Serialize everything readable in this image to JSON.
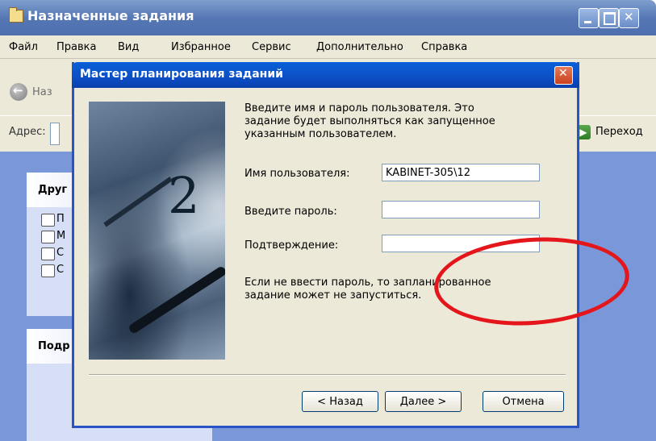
{
  "main_window": {
    "title": "Назначенные задания",
    "menu": [
      "Файл",
      "Правка",
      "Вид",
      "Избранное",
      "Сервис",
      "Дополнительно",
      "Справка"
    ],
    "back_label": "Наз",
    "address_label": "Адрес:",
    "go_label": "Переход",
    "panel_other_title": "Друг",
    "panel_details_title": "Подр",
    "panel_links": [
      "П",
      "М",
      "С",
      "С"
    ]
  },
  "wizard": {
    "title": "Мастер планирования заданий",
    "intro": "Введите имя и пароль пользователя.  Это задание будет выполняться как запущенное указанным пользователем.",
    "username_label": "Имя пользователя:",
    "username_value": "KABINET-305\\12",
    "password_label": "Введите пароль:",
    "password_value": "",
    "confirm_label": "Подтверждение:",
    "confirm_value": "",
    "note": "Если не ввести пароль, то запланированное задание может не запуститься.",
    "buttons": {
      "back": "< Назад",
      "next": "Далее >",
      "cancel": "Отмена"
    }
  },
  "annotation_color": "#e4161b"
}
